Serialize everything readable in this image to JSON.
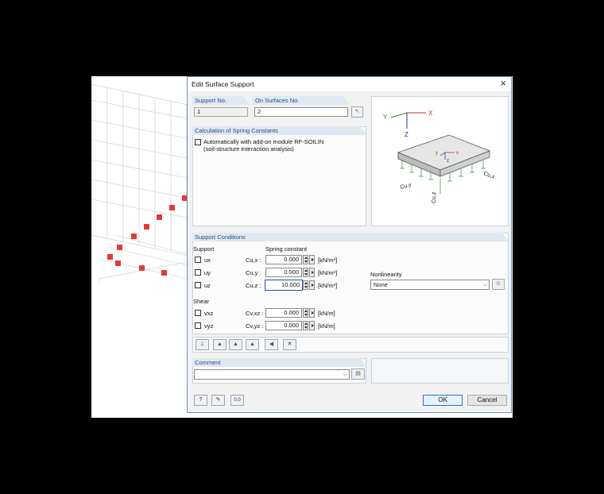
{
  "dialog": {
    "title": "Edit Surface Support"
  },
  "support_no": {
    "label": "Support No.",
    "value": "1"
  },
  "on_surfaces": {
    "label": "On Surfaces No.",
    "value": "2"
  },
  "calc": {
    "header": "Calculation of Spring Constants",
    "checkbox_line1": "Automatically with add-on module RF-SOILIN",
    "checkbox_line2": "(soil-structure interaction analysis)"
  },
  "illustration": {
    "axis_x": "X",
    "axis_y": "Y",
    "axis_z": "Z",
    "local_x": "x",
    "local_y": "y",
    "local_z": "z",
    "cux": "Cu,x",
    "cuy": "Cu,y",
    "cuz": "Cu,z"
  },
  "conditions": {
    "header": "Support Conditions",
    "support_label": "Support",
    "spring_label": "Spring constant",
    "shear_label": "Shear",
    "rows": [
      {
        "dof": "ux",
        "coef": "Cu,x :",
        "value": "0.000",
        "unit": "[kN/m³]"
      },
      {
        "dof": "uy",
        "coef": "Cu,y :",
        "value": "0.000",
        "unit": "[kN/m³]"
      },
      {
        "dof": "uz",
        "coef": "Cu,z :",
        "value": "10.000",
        "unit": "[kN/m³]"
      }
    ],
    "shear_rows": [
      {
        "dof": "vxz",
        "coef": "Cv,xz :",
        "value": "0.000",
        "unit": "[kN/m]"
      },
      {
        "dof": "vyz",
        "coef": "Cv,yz :",
        "value": "0.000",
        "unit": "[kN/m]"
      }
    ],
    "nonlinearity_label": "Nonlinearity",
    "nonlinearity_value": "None"
  },
  "comment": {
    "header": "Comment",
    "value": ""
  },
  "buttons": {
    "ok": "OK",
    "cancel": "Cancel"
  },
  "accent": "#1e4f87"
}
